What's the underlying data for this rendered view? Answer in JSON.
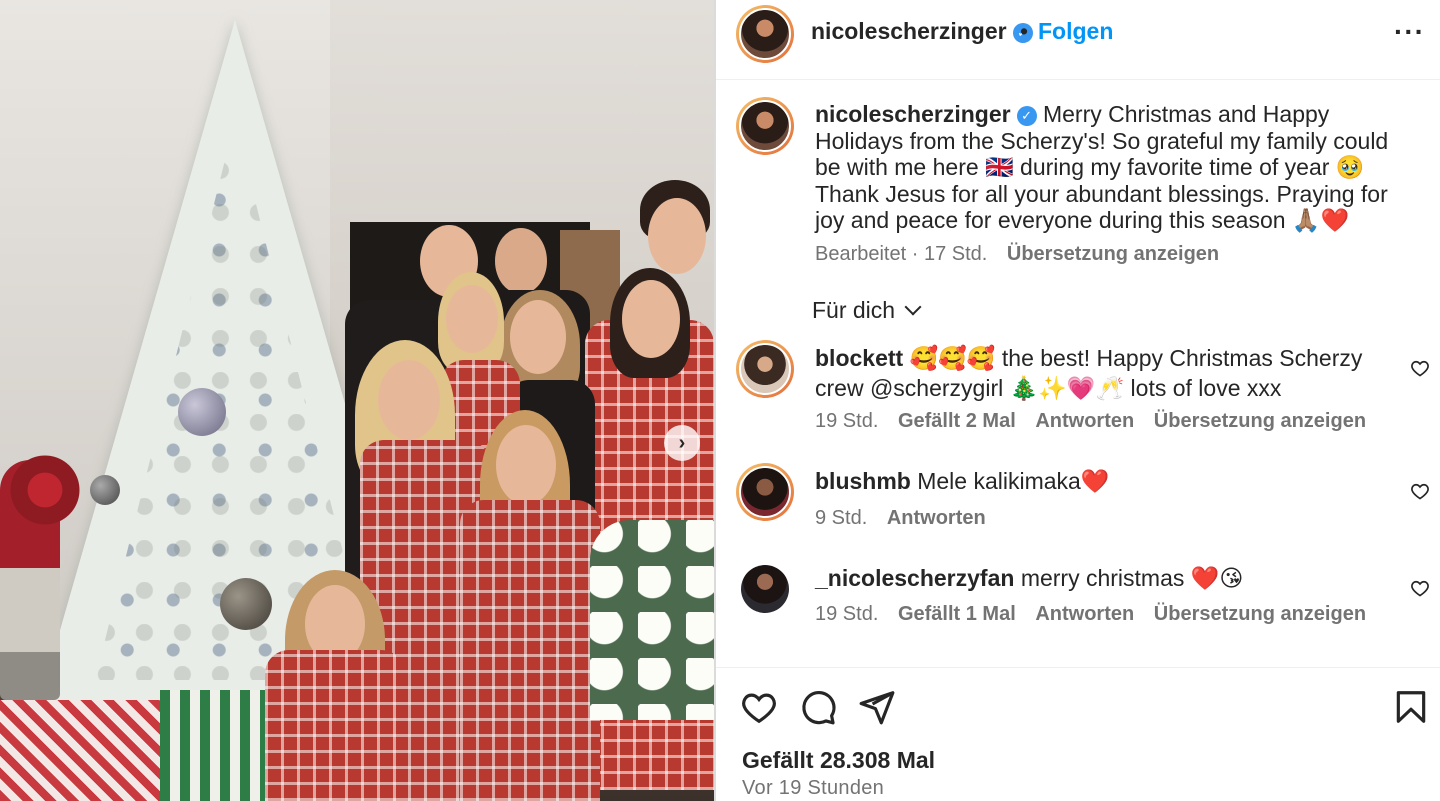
{
  "post": {
    "author": "nicolescherzinger",
    "verified_mark": "✓",
    "separator": "•",
    "follow_label": "Folgen",
    "more_label": "···",
    "next_label": "›"
  },
  "caption": {
    "username": "nicolescherzinger",
    "text": "Merry Christmas and Happy Holidays from the Scherzy's! So grateful my family could be with me here 🇬🇧 during my favorite time of year 🥹 Thank Jesus for all your abundant blessings. Praying for joy and peace for everyone during this season 🙏🏽❤️",
    "edited": "Bearbeitet · 17 Std.",
    "translate_label": "Übersetzung anzeigen"
  },
  "filter": {
    "label": "Für dich"
  },
  "comments": [
    {
      "username": "blockett",
      "text": "🥰🥰🥰 the best! Happy Christmas Scherzy crew @scherzygirl 🎄✨💗🥂 lots of love xxx",
      "time": "19 Std.",
      "likes": "Gefällt 2 Mal",
      "reply_label": "Antworten",
      "translate_label": "Übersetzung anzeigen"
    },
    {
      "username": "blushmb",
      "text": "Mele kalikimaka❤️",
      "time": "9 Std.",
      "reply_label": "Antworten"
    },
    {
      "username": "_nicolescherzyfan",
      "text": "merry christmas ❤️😘",
      "time": "19 Std.",
      "likes": "Gefällt 1 Mal",
      "reply_label": "Antworten",
      "translate_label": "Übersetzung anzeigen"
    }
  ],
  "actions": {
    "like_icon": "heart-icon",
    "comment_icon": "comment-icon",
    "share_icon": "share-icon",
    "save_icon": "bookmark-icon",
    "likes_count": "Gefällt 28.308 Mal",
    "posted": "Vor 19 Stunden"
  },
  "colors": {
    "accent": "#0095f6",
    "verified": "#3897f0",
    "text": "#262626",
    "muted": "#737373"
  }
}
